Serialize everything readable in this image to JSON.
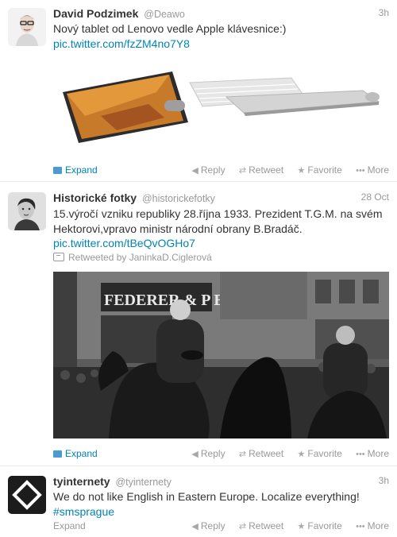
{
  "tweets": [
    {
      "fullname": "David Podzimek",
      "username": "@Deawo",
      "time": "3h",
      "text": "Nový tablet od Lenovo vedle Apple klávesnice:)",
      "link": "pic.twitter.com/fzZM4no7Y8",
      "expand": "Expand"
    },
    {
      "fullname": "Historické fotky",
      "username": "@historickefotky",
      "time": "28 Oct",
      "text_line1": "15.výročí vzniku republiky 28.října 1933. Prezident T.G.M. na svém",
      "text_line2": "Hektorovi,vpravo ministr národní obrany B.Bradáč.",
      "link": "pic.twitter.com/tBeQvOGHo7",
      "retweeted_by": "Retweeted by JaninkaD.Ciglerová",
      "photo_sign": "FEDERER & P   EN",
      "expand": "Expand"
    },
    {
      "fullname": "tyinternety",
      "username": "@tyinternety",
      "time": "3h",
      "text": "We do not like English in Eastern Europe. Localize everything!",
      "hashtag": "#smsprague",
      "expand": "Expand"
    }
  ],
  "actions": {
    "reply": "Reply",
    "retweet": "Retweet",
    "favorite": "Favorite",
    "more": "More"
  },
  "colors": {
    "link": "#0084b4",
    "meta": "#999999",
    "text": "#333333",
    "divider": "#e8e8e8"
  },
  "icons": {
    "reply": "reply-arrow-icon",
    "retweet": "retweet-arrows-icon",
    "favorite": "star-icon",
    "more": "ellipsis-icon",
    "expand": "media-card-icon"
  }
}
